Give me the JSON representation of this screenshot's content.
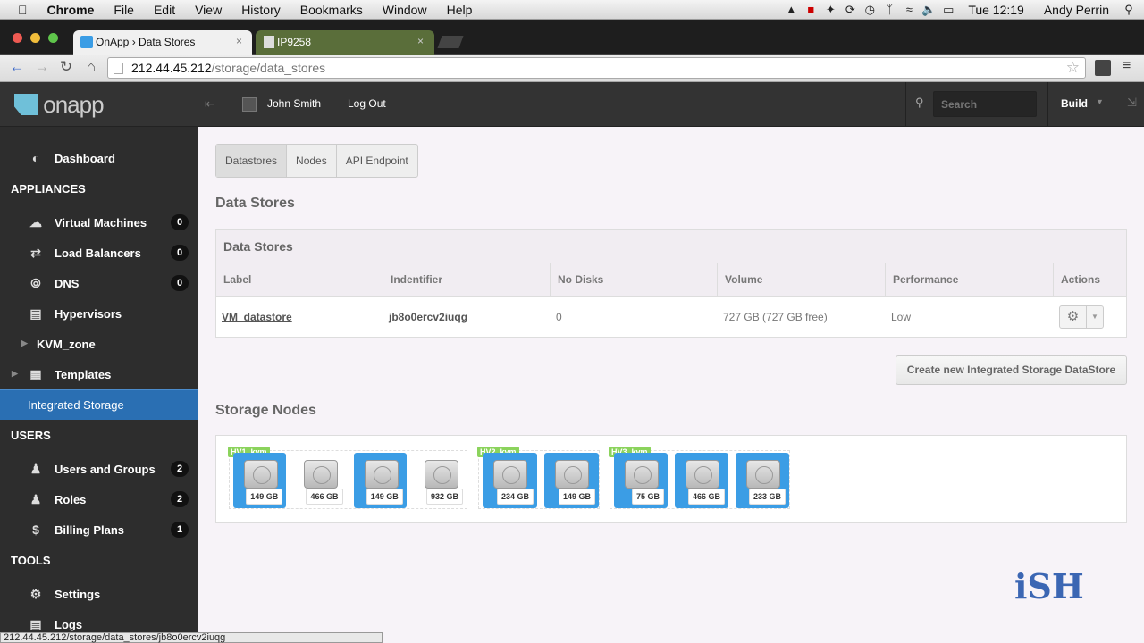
{
  "menubar": {
    "app": "Chrome",
    "items": [
      "File",
      "Edit",
      "View",
      "History",
      "Bookmarks",
      "Window",
      "Help"
    ],
    "clock": "Tue 12:19",
    "user": "Andy Perrin"
  },
  "tabs": [
    {
      "title": "OnApp › Data Stores"
    },
    {
      "title": "IP9258"
    }
  ],
  "address": {
    "host": "212.44.45.212",
    "path": "/storage/data_stores"
  },
  "logo": "onapp",
  "topbar": {
    "user": "John Smith",
    "logout": "Log Out",
    "search_placeholder": "Search",
    "build": "Build"
  },
  "sidebar": {
    "dashboard": "Dashboard",
    "appliances_title": "APPLIANCES",
    "appliances": [
      {
        "label": "Virtual Machines",
        "icon": "cloud-icon",
        "count": "0"
      },
      {
        "label": "Load Balancers",
        "icon": "shuffle-icon",
        "count": "0"
      },
      {
        "label": "DNS",
        "icon": "compass-icon",
        "count": "0"
      },
      {
        "label": "Hypervisors",
        "icon": "server-icon",
        "count": ""
      },
      {
        "label": "KVM_zone",
        "icon": "",
        "count": ""
      },
      {
        "label": "Templates",
        "icon": "grid-icon",
        "count": ""
      }
    ],
    "active": "Integrated Storage",
    "users_title": "USERS",
    "users": [
      {
        "label": "Users and Groups",
        "count": "2"
      },
      {
        "label": "Roles",
        "count": "2"
      },
      {
        "label": "Billing Plans",
        "count": "1"
      }
    ],
    "tools_title": "TOOLS",
    "tools": [
      {
        "label": "Settings"
      },
      {
        "label": "Logs"
      }
    ]
  },
  "subtabs": [
    "Datastores",
    "Nodes",
    "API Endpoint"
  ],
  "page_title": "Data Stores",
  "table": {
    "title": "Data Stores",
    "columns": [
      "Label",
      "Indentifier",
      "No Disks",
      "Volume",
      "Performance",
      "Actions"
    ],
    "rows": [
      {
        "label": "VM_datastore",
        "identifier": "jb8o0ercv2iuqg",
        "disks": "0",
        "volume": "727 GB (727 GB free)",
        "performance": "Low"
      }
    ]
  },
  "create_button": "Create new Integrated Storage DataStore",
  "nodes_title": "Storage Nodes",
  "node_groups": [
    {
      "name": "HV1_kvm",
      "nodes": [
        {
          "cap": "149 GB",
          "active": true
        },
        {
          "cap": "466 GB",
          "active": false
        },
        {
          "cap": "149 GB",
          "active": true
        },
        {
          "cap": "932 GB",
          "active": false
        }
      ]
    },
    {
      "name": "HV2_kvm",
      "nodes": [
        {
          "cap": "234 GB",
          "active": true
        },
        {
          "cap": "149 GB",
          "active": true
        }
      ]
    },
    {
      "name": "HV3_kvm",
      "nodes": [
        {
          "cap": "75 GB",
          "active": true
        },
        {
          "cap": "466 GB",
          "active": true
        },
        {
          "cap": "233 GB",
          "active": true
        }
      ]
    }
  ],
  "statusbar": "212.44.45.212/storage/data_stores/jb8o0ercv2iuqg",
  "watermark": "iSH"
}
